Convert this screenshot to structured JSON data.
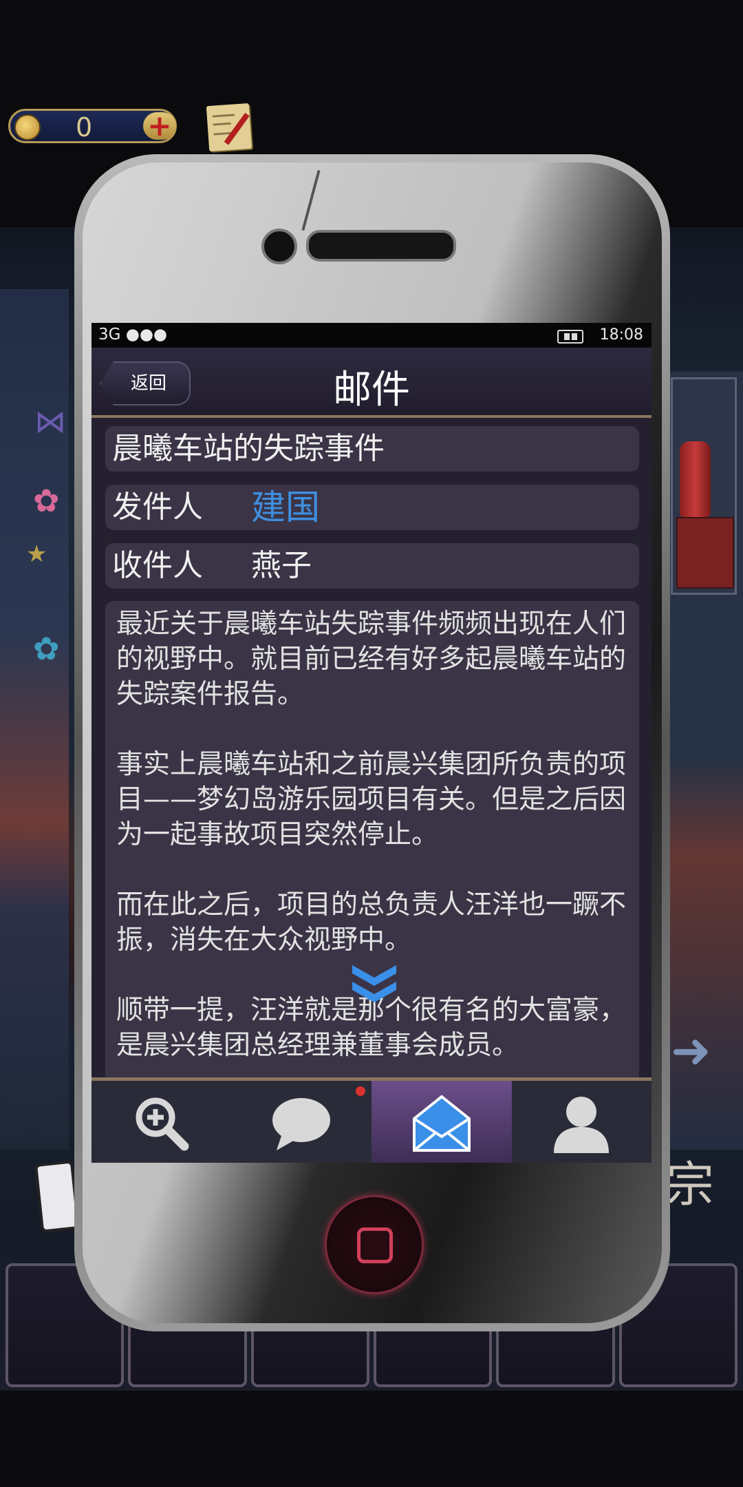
{
  "hud": {
    "coin_count": "0",
    "add_symbol": "+"
  },
  "screen": {
    "status": {
      "carrier": "3G ●●●",
      "time": "18:08"
    },
    "nav": {
      "back_label": "返回",
      "title": "邮件"
    },
    "mail": {
      "subject": "晨曦车站的失踪事件",
      "sender_label": "发件人",
      "sender_name": "建国",
      "recipient_label": "收件人",
      "recipient_name": "燕子",
      "body": "最近关于晨曦车站失踪事件频频出现在人们的视野中。就目前已经有好多起晨曦车站的失踪案件报告。\n\n事实上晨曦车站和之前晨兴集团所负责的项目——梦幻岛游乐园项目有关。但是之后因为一起事故项目突然停止。\n\n而在此之后，项目的总负责人汪洋也一蹶不振，消失在大众视野中。\n\n顺带一提，汪洋就是那个很有名的大富豪，是晨兴集团总经理兼董事会成员。"
    },
    "tabs": [
      {
        "icon": "search-icon",
        "active": false,
        "badge": false
      },
      {
        "icon": "chat-bubble-icon",
        "active": false,
        "badge": true
      },
      {
        "icon": "mail-icon",
        "active": true,
        "badge": false
      },
      {
        "icon": "contact-icon",
        "active": false,
        "badge": false
      }
    ]
  },
  "background": {
    "side_glyph": "宗"
  },
  "colors": {
    "sender_name": "#3f8fe0",
    "active_tab": "#6b4e8a",
    "badge": "#d8312f",
    "nav_border": "#8a7660"
  }
}
